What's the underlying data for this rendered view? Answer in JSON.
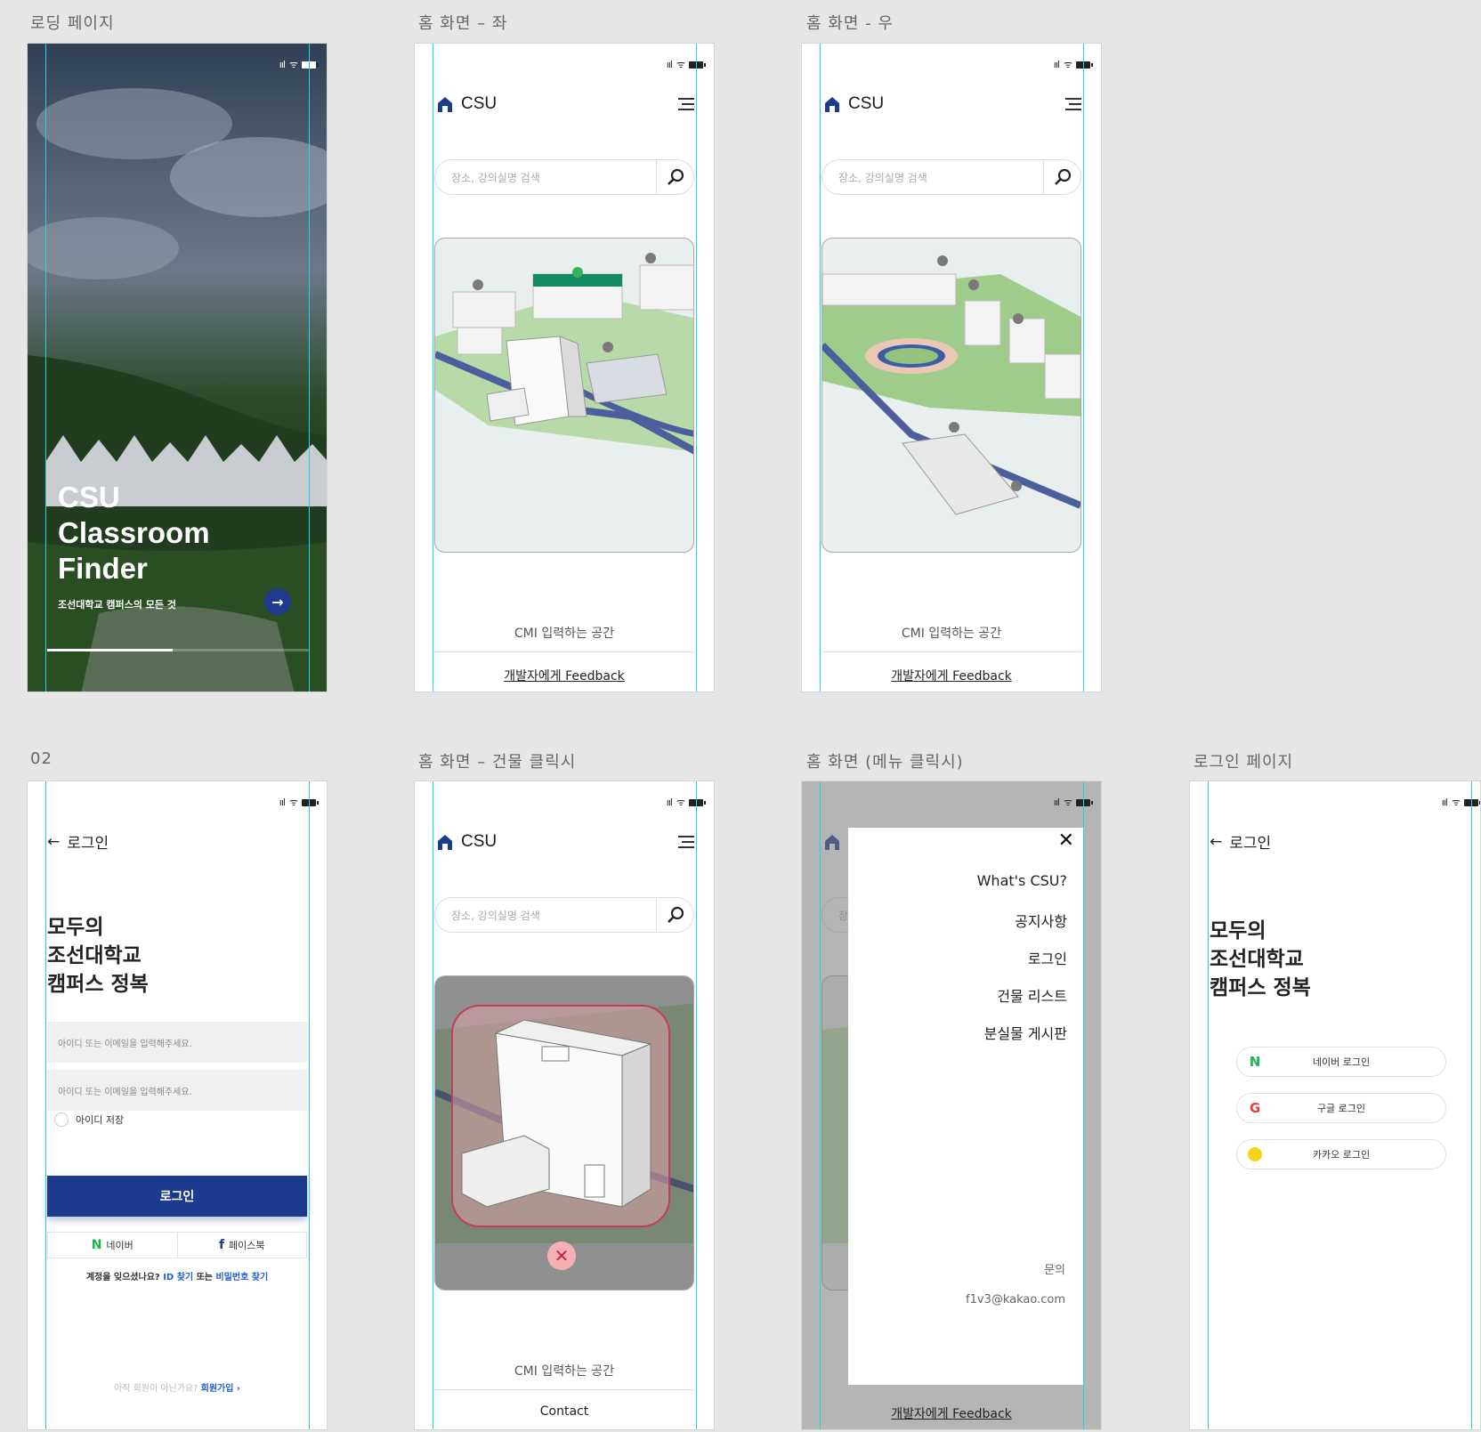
{
  "frames": {
    "loading": "로딩 페이지",
    "home_left": "홈 화면 – 좌",
    "home_right": "홈 화면 - 우",
    "login_02": "02",
    "home_building": "홈 화면 – 건물 클릭시",
    "home_menu": "홈 화면 (메뉴 클릭시)",
    "login_page": "로그인 페이지"
  },
  "status_bar": {
    "signal": "ııl",
    "wifi": "ᯤ"
  },
  "loading": {
    "title_line1": "CSU",
    "title_line2": "Classroom",
    "title_line3": "Finder",
    "subtitle": "조선대학교 캠퍼스의 모든 것",
    "arrow": "→",
    "progress": 0.48
  },
  "home": {
    "brand": "CSU",
    "search_placeholder": "장소, 강의실명 검색",
    "cmi_text": "CMI 입력하는 공간",
    "feedback_link": "개발자에게 Feedback",
    "contact_link": "Contact"
  },
  "login": {
    "back_label": "로그인",
    "headline_line1": "모두의",
    "headline_line2": "조선대학교",
    "headline_line3": "캠퍼스 정복",
    "id_placeholder": "아이디 또는 이메일을 입력해주세요.",
    "pw_placeholder": "아이디 또는 이메일을 입력해주세요.",
    "save_id": "아이디 저장",
    "login_button": "로그인",
    "naver": "네이버",
    "facebook": "페이스북",
    "forgot_prefix": "계정을 잊으셨나요?",
    "find_id": "ID 찾기",
    "or": "또는",
    "find_pw": "비밀번호 찾기",
    "not_member": "아직 회원이 아닌가요?",
    "signup": "회원가입 ›"
  },
  "social_login": {
    "naver": "네이버 로그인",
    "google": "구글 로그인",
    "kakao": "카카오 로그인"
  },
  "menu": {
    "close": "✕",
    "items": [
      "What's CSU?",
      "공지사항",
      "로그인",
      "건물 리스트",
      "분실물 게시판"
    ],
    "contact_label": "문의",
    "contact_email": "f1v3@kakao.com"
  },
  "colors": {
    "primary": "#1c3a8e",
    "guide": "#19d7e3",
    "naver": "#19b54a",
    "popup_border": "#c83b5a"
  }
}
